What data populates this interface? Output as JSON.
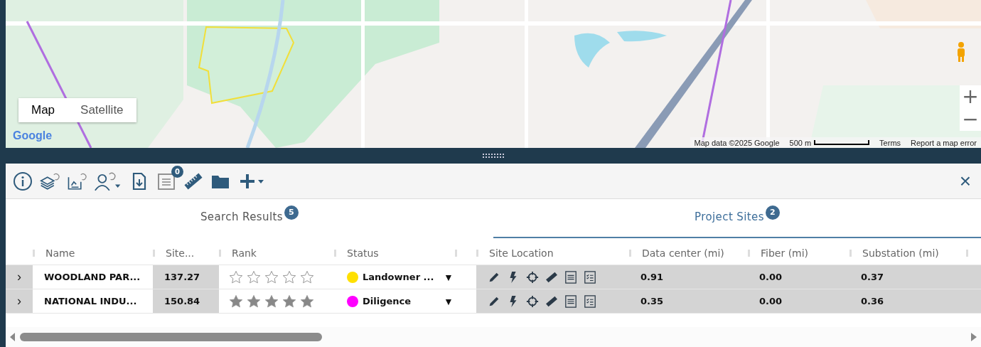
{
  "map": {
    "map_types": [
      {
        "label": "Map",
        "selected": true
      },
      {
        "label": "Satellite",
        "selected": false
      }
    ],
    "logo": "Google",
    "attribution": "Map data ©2025 Google",
    "scale": "500 m",
    "terms": "Terms",
    "report": "Report a map error",
    "zoom_in": "+",
    "zoom_out": "−"
  },
  "toolbar": {
    "notes_badge": "0",
    "close": "×"
  },
  "tabs": [
    {
      "label": "Search Results",
      "count": "5",
      "selected": false
    },
    {
      "label": "Project Sites",
      "count": "2",
      "selected": true
    }
  ],
  "table": {
    "columns": [
      "Name",
      "Site...",
      "Rank",
      "Status",
      "Site Location",
      "Data center (mi)",
      "Fiber (mi)",
      "Substation (mi)"
    ],
    "rows": [
      {
        "expander": "›",
        "name": "WOODLAND PAR...",
        "site": "137.27",
        "stars": 0,
        "status": "Landowner ...",
        "color": "#ffe000",
        "dropdown": "▼",
        "data_center": "0.91",
        "fiber": "0.00",
        "substation": "0.37"
      },
      {
        "expander": "›",
        "name": "NATIONAL INDU...",
        "site": "150.84",
        "stars": 5,
        "status": "Diligence",
        "color": "#ff00ff",
        "dropdown": "▼",
        "data_center": "0.35",
        "fiber": "0.00",
        "substation": "0.36"
      }
    ]
  }
}
